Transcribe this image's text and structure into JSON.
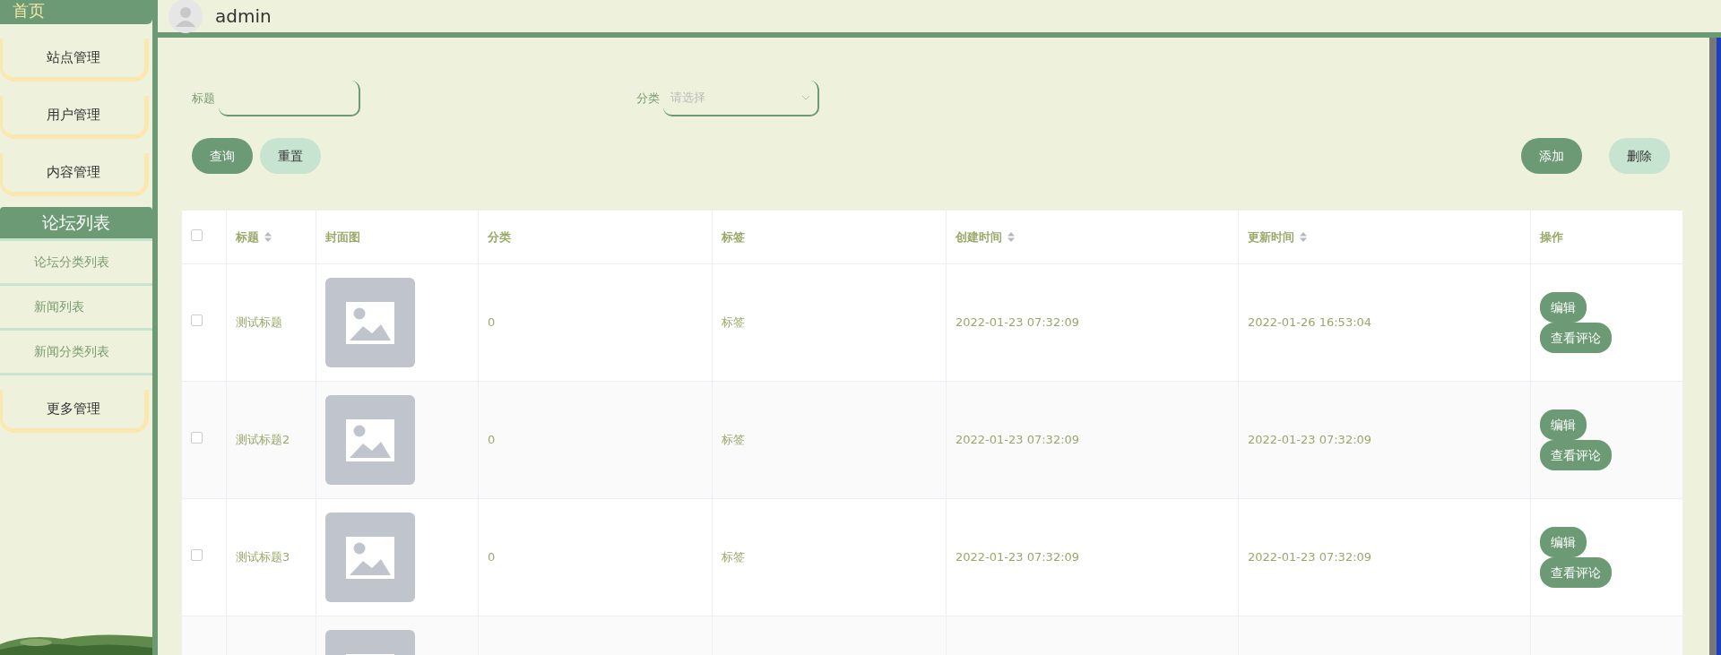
{
  "sidebar": {
    "home": "首页",
    "items": [
      {
        "kind": "menu",
        "label": "站点管理"
      },
      {
        "kind": "menu",
        "label": "用户管理"
      },
      {
        "kind": "menu",
        "label": "内容管理"
      },
      {
        "kind": "group",
        "label": "论坛列表",
        "children": [
          {
            "label": "论坛分类列表"
          },
          {
            "label": "新闻列表"
          },
          {
            "label": "新闻分类列表"
          }
        ]
      },
      {
        "kind": "menu",
        "label": "更多管理"
      }
    ]
  },
  "header": {
    "user": "admin"
  },
  "search": {
    "fields": [
      {
        "kind": "text",
        "label": "标题"
      },
      {
        "kind": "select",
        "label": "分类",
        "placeholder": "请选择"
      }
    ],
    "buttons": [
      {
        "label": "查询",
        "primary": true
      },
      {
        "label": "重置",
        "primary": false
      }
    ],
    "actions": [
      {
        "label": "添加",
        "primary": true
      },
      {
        "label": "删除",
        "primary": false
      }
    ]
  },
  "table": {
    "header_checked": false,
    "columns": [
      {
        "label": "标题",
        "sortable": true
      },
      {
        "label": "封面图",
        "sortable": false
      },
      {
        "label": "分类",
        "sortable": false
      },
      {
        "label": "标签",
        "sortable": false
      },
      {
        "label": "创建时间",
        "sortable": true
      },
      {
        "label": "更新时间",
        "sortable": true
      },
      {
        "label": "操作",
        "sortable": false
      }
    ],
    "rows": [
      {
        "checked": false,
        "title": "测试标题",
        "cover_shown": true,
        "category": "0",
        "tag": "标签",
        "created": "2022-01-23 07:32:09",
        "updated": "2022-01-26 16:53:04",
        "actions": [
          "编辑",
          "查看评论"
        ]
      },
      {
        "checked": false,
        "title": "测试标题2",
        "cover_shown": true,
        "category": "0",
        "tag": "标签",
        "created": "2022-01-23 07:32:09",
        "updated": "2022-01-23 07:32:09",
        "actions": [
          "编辑",
          "查看评论"
        ]
      },
      {
        "checked": false,
        "title": "测试标题3",
        "cover_shown": true,
        "category": "0",
        "tag": "标签",
        "created": "2022-01-23 07:32:09",
        "updated": "2022-01-23 07:32:09",
        "actions": [
          "编辑",
          "查看评论"
        ]
      },
      {
        "cover_shown": true
      }
    ]
  }
}
